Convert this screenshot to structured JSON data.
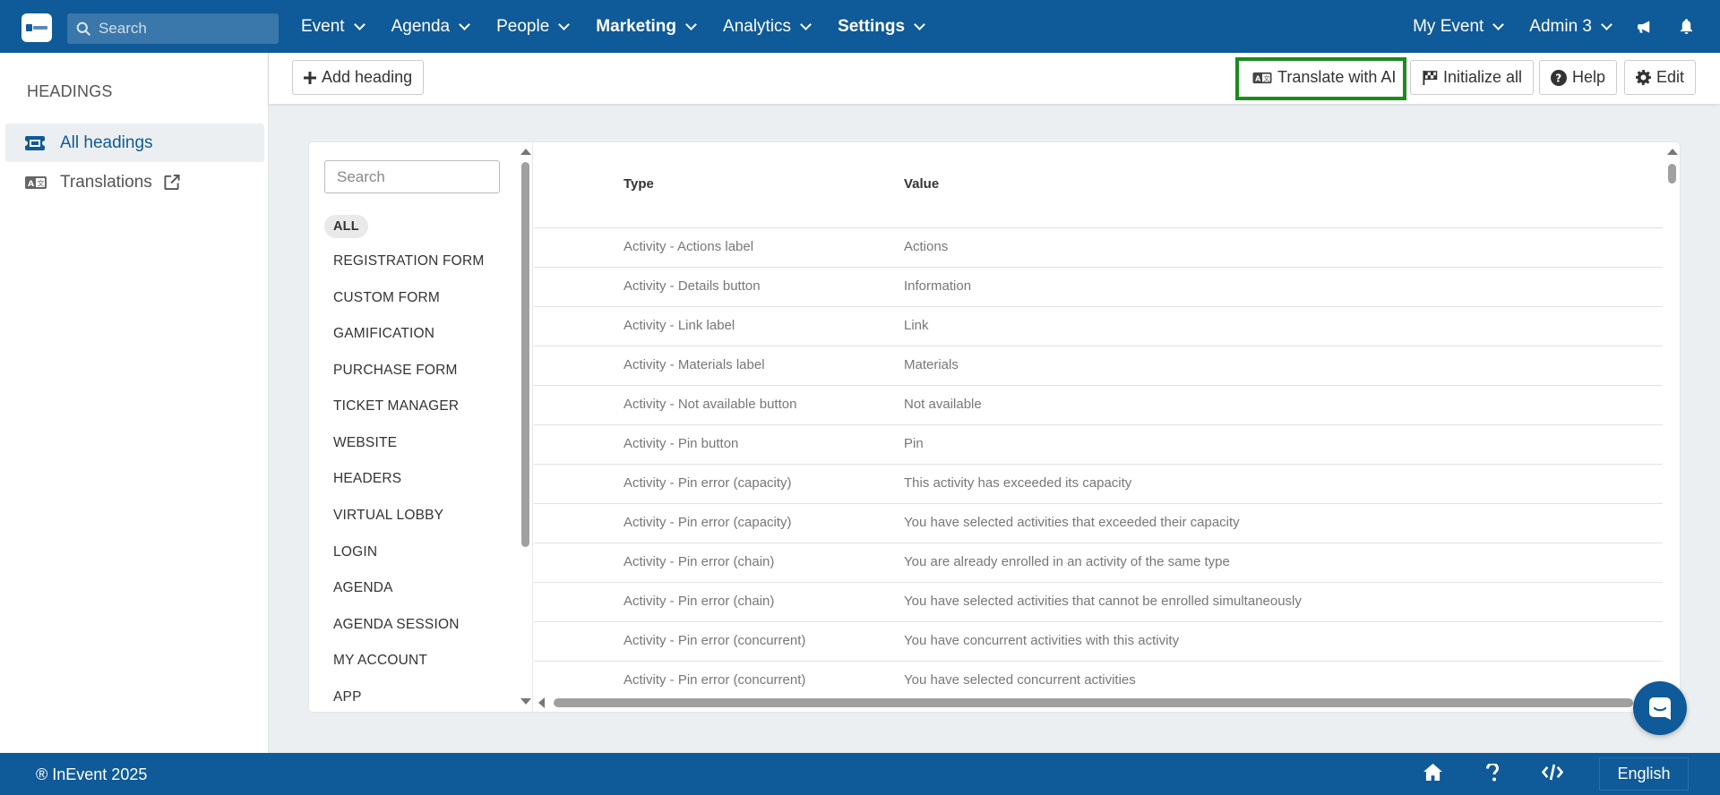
{
  "topbar": {
    "logo_text": "inEvent",
    "search_placeholder": "Search",
    "menu": [
      {
        "label": "Event",
        "bold": false
      },
      {
        "label": "Agenda",
        "bold": false
      },
      {
        "label": "People",
        "bold": false
      },
      {
        "label": "Marketing",
        "bold": true
      },
      {
        "label": "Analytics",
        "bold": false
      },
      {
        "label": "Settings",
        "bold": true
      }
    ],
    "event_selector": "My Event",
    "user_menu": "Admin 3"
  },
  "sidebar": {
    "title": "HEADINGS",
    "items": [
      {
        "label": "All headings",
        "icon": "ticket-icon",
        "active": true
      },
      {
        "label": "Translations",
        "icon": "translate-icon",
        "active": false
      }
    ]
  },
  "toolbar": {
    "add_heading": "Add heading",
    "translate_ai": "Translate with AI",
    "initialize_all": "Initialize all",
    "help": "Help",
    "edit": "Edit"
  },
  "filters": {
    "search_placeholder": "Search",
    "items": [
      "ALL",
      "REGISTRATION FORM",
      "CUSTOM FORM",
      "GAMIFICATION",
      "PURCHASE FORM",
      "TICKET MANAGER",
      "WEBSITE",
      "HEADERS",
      "VIRTUAL LOBBY",
      "LOGIN",
      "AGENDA",
      "AGENDA SESSION",
      "MY ACCOUNT",
      "APP"
    ]
  },
  "table": {
    "headers": {
      "type": "Type",
      "value": "Value"
    },
    "rows": [
      {
        "type": "Activity - Actions label",
        "value": "Actions"
      },
      {
        "type": "Activity - Details button",
        "value": "Information"
      },
      {
        "type": "Activity - Link label",
        "value": "Link"
      },
      {
        "type": "Activity - Materials label",
        "value": "Materials"
      },
      {
        "type": "Activity - Not available button",
        "value": "Not available"
      },
      {
        "type": "Activity - Pin button",
        "value": "Pin"
      },
      {
        "type": "Activity - Pin error (capacity)",
        "value": "This activity has exceeded its capacity"
      },
      {
        "type": "Activity - Pin error (capacity)",
        "value": "You have selected activities that exceeded their capacity"
      },
      {
        "type": "Activity - Pin error (chain)",
        "value": "You are already enrolled in an activity of the same type"
      },
      {
        "type": "Activity - Pin error (chain)",
        "value": "You have selected activities that cannot be enrolled simultaneously"
      },
      {
        "type": "Activity - Pin error (concurrent)",
        "value": "You have concurrent activities with this activity"
      },
      {
        "type": "Activity - Pin error (concurrent)",
        "value": "You have selected concurrent activities"
      }
    ]
  },
  "footer": {
    "copyright": "® InEvent 2025",
    "language": "English"
  },
  "colors": {
    "brand": "#0f5a98",
    "highlight": "#1e8a1e"
  }
}
